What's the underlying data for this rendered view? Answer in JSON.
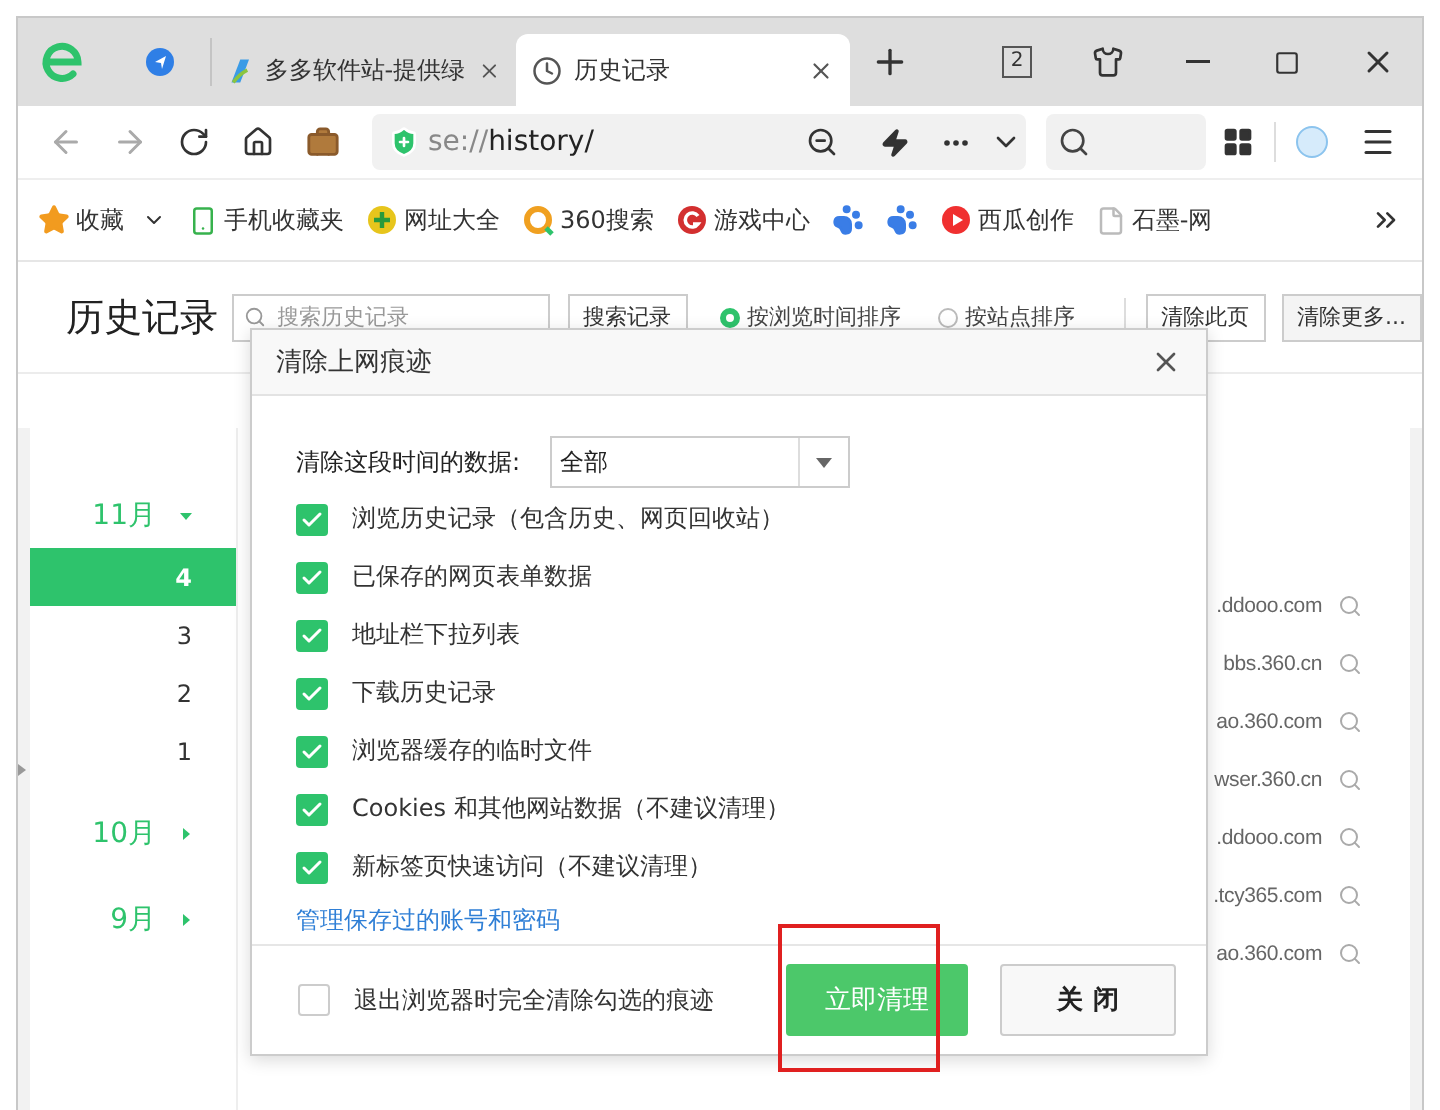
{
  "tabs": [
    {
      "kind": "pinned",
      "selected": false
    },
    {
      "kind": "page",
      "label": "多多软件站-提供绿",
      "selected": false
    },
    {
      "kind": "page",
      "label": "历史记录",
      "selected": true
    }
  ],
  "window_controls": {
    "tab_count": "2"
  },
  "address_bar": {
    "url_scheme": "se://",
    "url_path": "history/"
  },
  "bookmarks": [
    {
      "kind": "favorites",
      "label": "收藏"
    },
    {
      "kind": "phone",
      "label": "手机收藏夹"
    },
    {
      "kind": "sites",
      "label": "网址大全"
    },
    {
      "kind": "search360",
      "label": "360搜索"
    },
    {
      "kind": "games",
      "label": "游戏中心"
    },
    {
      "kind": "paw"
    },
    {
      "kind": "paw"
    },
    {
      "kind": "video",
      "label": "西瓜创作"
    },
    {
      "kind": "doc",
      "label": "石墨-网"
    }
  ],
  "history_page": {
    "title": "历史记录",
    "search": {
      "placeholder": "搜索历史记录"
    },
    "search_button": "搜索记录",
    "sort_options": [
      {
        "label": "按浏览时间排序",
        "selected": true
      },
      {
        "label": "按站点排序",
        "selected": false
      }
    ],
    "actions": [
      "清除此页",
      "清除更多..."
    ]
  },
  "sidebar": {
    "months": [
      {
        "label": "11月",
        "expanded": true,
        "days": [
          {
            "label": "4",
            "selected": true
          },
          {
            "label": "3",
            "selected": false
          },
          {
            "label": "2",
            "selected": false
          },
          {
            "label": "1",
            "selected": false
          }
        ]
      },
      {
        "label": "10月",
        "expanded": false
      },
      {
        "label": "9月",
        "expanded": false
      }
    ]
  },
  "history_domains": [
    ".ddooo.com",
    "bbs.360.cn",
    "ao.360.com",
    "wser.360.cn",
    ".ddooo.com",
    ".tcy365.com",
    "ao.360.com"
  ],
  "dialog": {
    "title": "清除上网痕迹",
    "range_label": "清除这段时间的数据:",
    "range_value": "全部",
    "options": [
      {
        "label": "浏览历史记录（包含历史、网页回收站）",
        "checked": true
      },
      {
        "label": "已保存的网页表单数据",
        "checked": true
      },
      {
        "label": "地址栏下拉列表",
        "checked": true
      },
      {
        "label": "下载历史记录",
        "checked": true
      },
      {
        "label": "浏览器缓存的临时文件",
        "checked": true
      },
      {
        "label": "Cookies 和其他网站数据（不建议清理）",
        "checked": true
      },
      {
        "label": "新标签页快速访问（不建议清理）",
        "checked": true
      }
    ],
    "link": "管理保存过的账号和密码",
    "exit_option": {
      "label": "退出浏览器时完全清除勾选的痕迹",
      "checked": false
    },
    "buttons": [
      {
        "kind": "primary",
        "label": "立即清理",
        "highlighted": true
      },
      {
        "kind": "secondary",
        "label": "关 闭",
        "highlighted": false
      }
    ]
  }
}
